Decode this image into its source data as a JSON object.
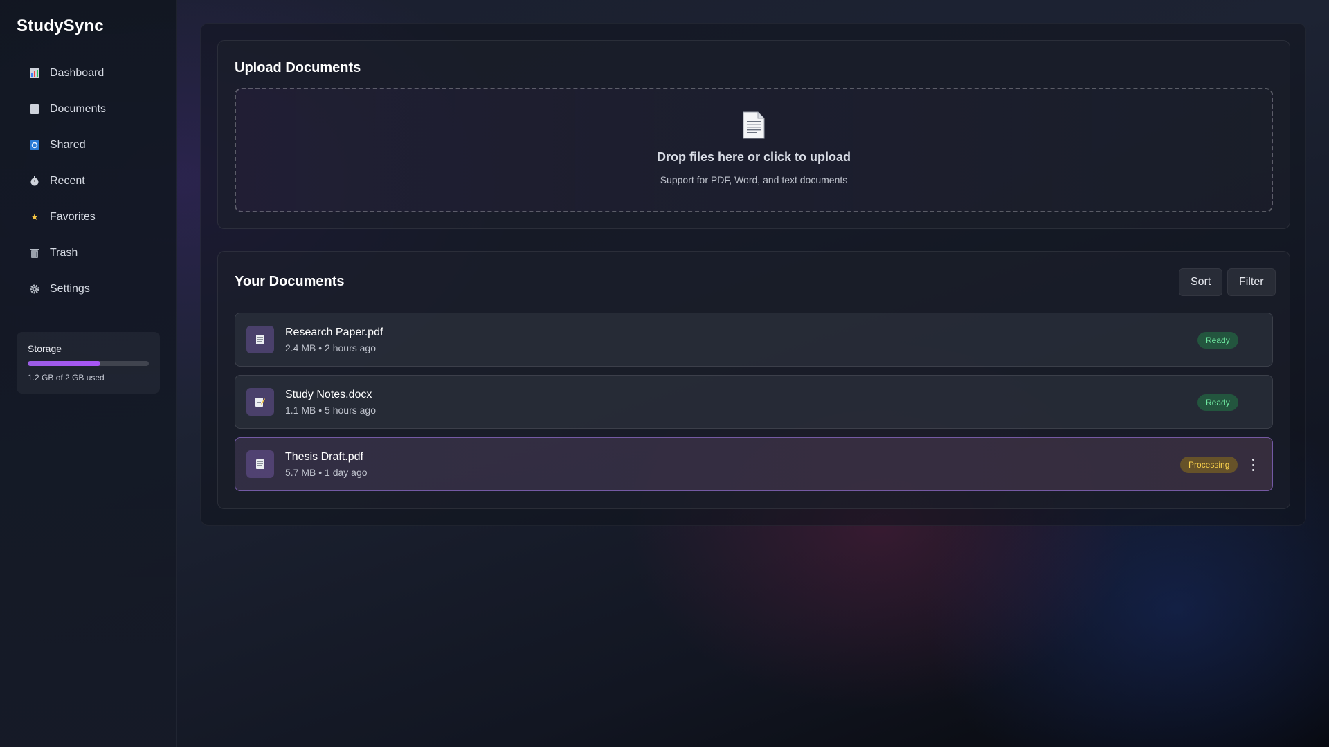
{
  "app": {
    "name": "StudySync"
  },
  "sidebar": {
    "items": [
      {
        "label": "Dashboard",
        "icon": "chart-icon"
      },
      {
        "label": "Documents",
        "icon": "document-icon"
      },
      {
        "label": "Shared",
        "icon": "shared-icon"
      },
      {
        "label": "Recent",
        "icon": "clock-icon"
      },
      {
        "label": "Favorites",
        "icon": "star-icon"
      },
      {
        "label": "Trash",
        "icon": "trash-icon"
      },
      {
        "label": "Settings",
        "icon": "gear-icon"
      }
    ],
    "storage": {
      "title": "Storage",
      "used_text": "1.2 GB of 2 GB used",
      "used_fraction": 0.6
    }
  },
  "upload": {
    "title": "Upload Documents",
    "drop_title": "Drop files here or click to upload",
    "drop_subtitle": "Support for PDF, Word, and text documents"
  },
  "documents": {
    "title": "Your Documents",
    "sort_label": "Sort",
    "filter_label": "Filter",
    "rows": [
      {
        "name": "Research Paper.pdf",
        "meta": "2.4 MB • 2 hours ago",
        "status": "Ready",
        "status_kind": "ready",
        "icon": "pdf-icon"
      },
      {
        "name": "Study Notes.docx",
        "meta": "1.1 MB • 5 hours ago",
        "status": "Ready",
        "status_kind": "ready",
        "icon": "notes-icon"
      },
      {
        "name": "Thesis Draft.pdf",
        "meta": "5.7 MB • 1 day ago",
        "status": "Processing",
        "status_kind": "processing",
        "icon": "pdf-icon"
      }
    ]
  },
  "colors": {
    "accent": "#a855f7",
    "ready": "#6ee7a0",
    "processing": "#fcd34d"
  }
}
